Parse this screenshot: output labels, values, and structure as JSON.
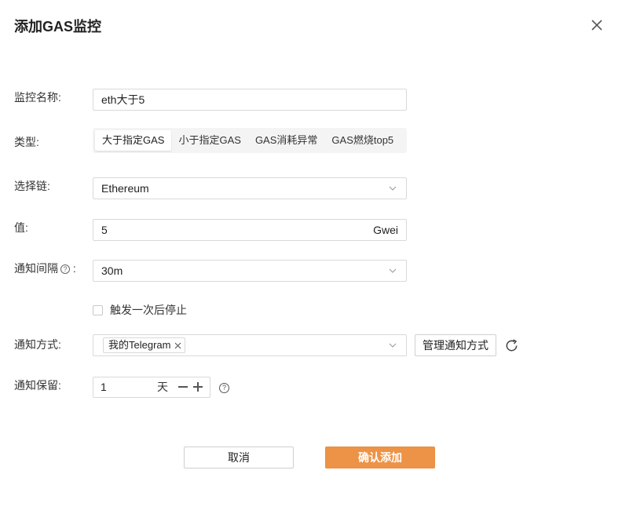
{
  "dialog": {
    "title": "添加GAS监控"
  },
  "form": {
    "name": {
      "label": "监控名称:",
      "value": "eth大于5"
    },
    "type": {
      "label": "类型:",
      "options": [
        "大于指定GAS",
        "小于指定GAS",
        "GAS消耗异常",
        "GAS燃烧top5"
      ],
      "selected": "大于指定GAS"
    },
    "chain": {
      "label": "选择链:",
      "value": "Ethereum"
    },
    "value": {
      "label": "值:",
      "value": "5",
      "unit": "Gwei"
    },
    "interval": {
      "label": "通知间隔",
      "help": "?",
      "colon": ":",
      "value": "30m"
    },
    "stop_once": {
      "label": "触发一次后停止",
      "checked": false
    },
    "method": {
      "label": "通知方式:",
      "tag": "我的Telegram",
      "manage_label": "管理通知方式"
    },
    "retention": {
      "label": "通知保留:",
      "value": "1",
      "unit": "天",
      "help": "?"
    }
  },
  "footer": {
    "cancel_label": "取消",
    "confirm_label": "确认添加"
  },
  "icons": {
    "close": "close-icon",
    "dropdown": "chevron-down-icon",
    "refresh": "refresh-icon",
    "help": "question-circle-icon",
    "tag_remove": "close-icon"
  },
  "colors": {
    "accent": "#ec9347",
    "border": "#d9d9d9",
    "segment_bg": "#f4f4f4"
  }
}
